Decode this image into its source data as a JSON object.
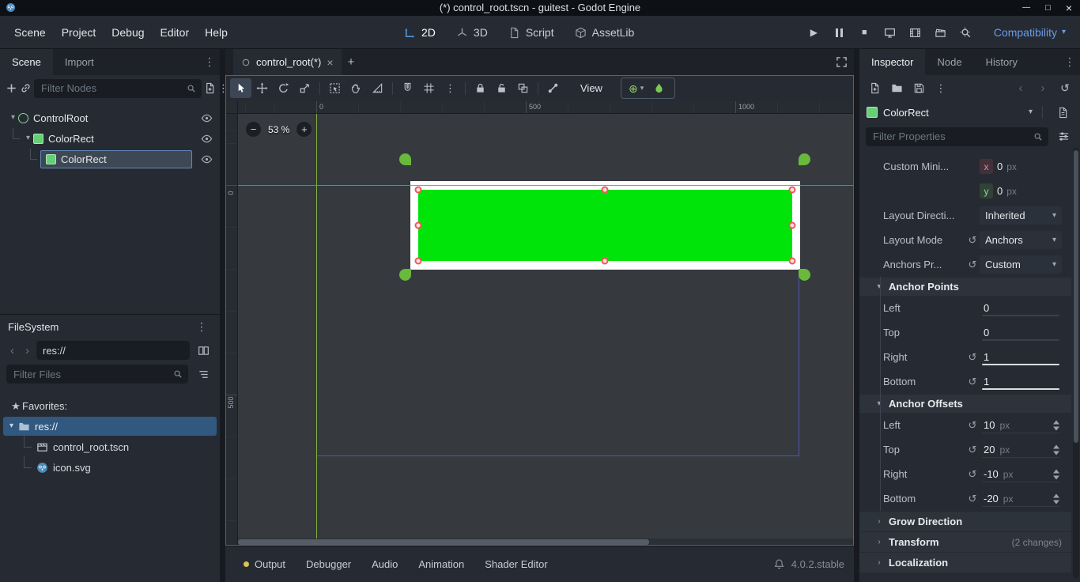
{
  "titlebar": {
    "title": "(*) control_root.tscn - guitest - Godot Engine"
  },
  "menubar": {
    "menus": [
      "Scene",
      "Project",
      "Debug",
      "Editor",
      "Help"
    ],
    "workspaces": [
      "2D",
      "3D",
      "Script",
      "AssetLib"
    ],
    "renderer_label": "Compatibility"
  },
  "scene_dock": {
    "tabs": [
      "Scene",
      "Import"
    ],
    "filter_placeholder": "Filter Nodes",
    "tree": {
      "root": "ControlRoot",
      "child": "ColorRect",
      "grandchild": "ColorRect"
    }
  },
  "filesystem": {
    "title": "FileSystem",
    "path": "res://",
    "filter_placeholder": "Filter Files",
    "favorites_label": "Favorites:",
    "folder": "res://",
    "file1": "control_root.tscn",
    "file2": "icon.svg"
  },
  "viewport": {
    "tab": "control_root(*)",
    "zoom": "53 %",
    "view": "View",
    "ruler_top": [
      "0",
      "500",
      "1000"
    ],
    "ruler_left": [
      "0",
      "500"
    ]
  },
  "inspector": {
    "tabs": [
      "Inspector",
      "Node",
      "History"
    ],
    "object": "ColorRect",
    "filter_placeholder": "Filter Properties",
    "custom_min": {
      "label": "Custom Mini...",
      "x": "0",
      "y": "0",
      "unit": "px"
    },
    "layout_direction": {
      "label": "Layout Directi...",
      "value": "Inherited"
    },
    "layout_mode": {
      "label": "Layout Mode",
      "value": "Anchors"
    },
    "anchors_preset": {
      "label": "Anchors Pr...",
      "value": "Custom"
    },
    "anchor_points": {
      "title": "Anchor Points",
      "rows": [
        {
          "label": "Left",
          "value": "0"
        },
        {
          "label": "Top",
          "value": "0"
        },
        {
          "label": "Right",
          "value": "1"
        },
        {
          "label": "Bottom",
          "value": "1"
        }
      ]
    },
    "anchor_offsets": {
      "title": "Anchor Offsets",
      "unit": "px",
      "rows": [
        {
          "label": "Left",
          "value": "10"
        },
        {
          "label": "Top",
          "value": "20"
        },
        {
          "label": "Right",
          "value": "-10"
        },
        {
          "label": "Bottom",
          "value": "-20"
        }
      ]
    },
    "grow_direction": {
      "title": "Grow Direction"
    },
    "transform": {
      "title": "Transform",
      "note": "(2 changes)"
    },
    "localization": {
      "title": "Localization"
    }
  },
  "bottom_bar": {
    "items": [
      "Output",
      "Debugger",
      "Audio",
      "Animation",
      "Shader Editor"
    ],
    "version": "4.0.2.stable"
  },
  "icons": {
    "dots": "⋮",
    "chevron_down": "▾",
    "collapse_open": "▾",
    "collapse_closed": "›",
    "back": "‹",
    "forward": "›",
    "close": "×",
    "minimize": "—",
    "maximize": "□",
    "play": "▶",
    "stop": "■",
    "zoom_in": "+",
    "zoom_out": "−",
    "plus": "+",
    "revert": "↺",
    "history": "↺",
    "star": "★",
    "preset_plus": "⊕"
  }
}
